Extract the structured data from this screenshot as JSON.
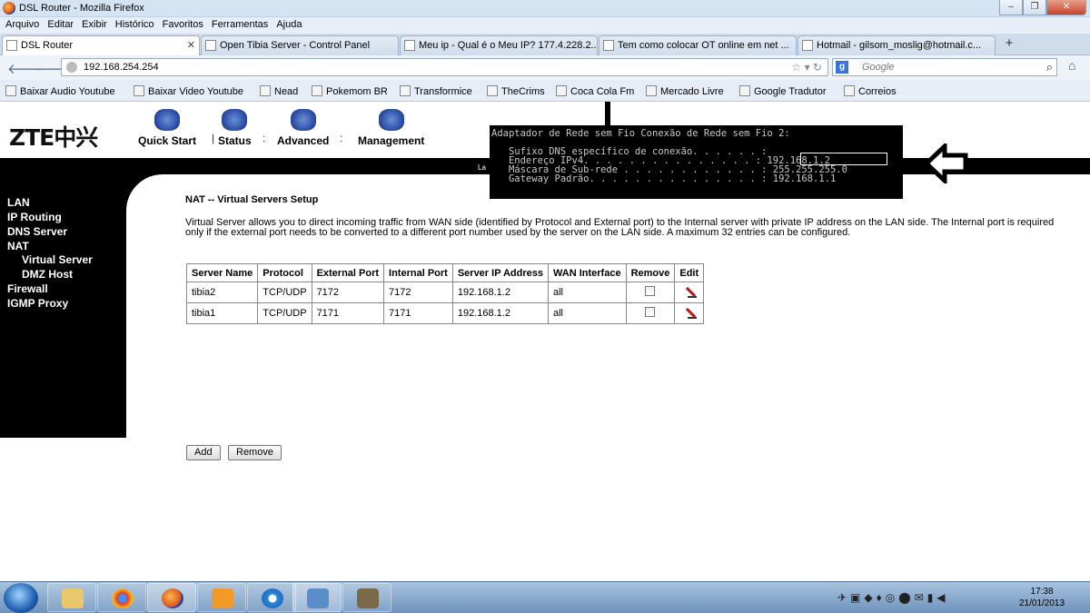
{
  "window": {
    "title": "DSL Router - Mozilla Firefox"
  },
  "menu": [
    "Arquivo",
    "Editar",
    "Exibir",
    "Histórico",
    "Favoritos",
    "Ferramentas",
    "Ajuda"
  ],
  "tabs": [
    {
      "label": "DSL Router"
    },
    {
      "label": "Open Tibia Server - Control Panel"
    },
    {
      "label": "Meu ip - Qual é o Meu IP? 177.4.228.2..."
    },
    {
      "label": "Tem como colocar OT online em net ..."
    },
    {
      "label": "Hotmail - gilsom_moslig@hotmail.c..."
    }
  ],
  "address": {
    "url": "192.168.254.254"
  },
  "search": {
    "placeholder": "Google"
  },
  "bookmarks": [
    "Baixar Audio Youtube",
    "Baixar Video Youtube",
    "Nead",
    "Pokemom BR",
    "Transformice",
    "TheCrims",
    "Coca Cola Fm",
    "Mercado Livre",
    "Google Tradutor",
    "Correios"
  ],
  "router": {
    "logo": "ZTE中兴",
    "topnav": {
      "quick_start": "Quick Start",
      "status": "Status",
      "advanced": "Advanced",
      "management": "Management"
    },
    "sidebar": {
      "lan": "LAN",
      "ip_routing": "IP Routing",
      "dns_server": "DNS Server",
      "nat": "NAT",
      "virtual_server": "Virtual Server",
      "dmz_host": "DMZ Host",
      "firewall": "Firewall",
      "igmp_proxy": "IGMP Proxy"
    },
    "page_title": "NAT -- Virtual Servers Setup",
    "description": "Virtual Server allows you to direct incoming traffic from WAN side (identified by Protocol and External port) to the Internal server with private IP address on the LAN side. The Internal port is required only if the external port needs to be converted to a different port number used by the server on the LAN side. A maximum 32 entries can be configured.",
    "table": {
      "headers": {
        "server_name": "Server Name",
        "protocol": "Protocol",
        "external_port": "External Port",
        "internal_port": "Internal Port",
        "server_ip": "Server IP Address",
        "wan_interface": "WAN Interface",
        "remove": "Remove",
        "edit": "Edit"
      },
      "rows": [
        {
          "server_name": "tibia2",
          "protocol": "TCP/UDP",
          "external_port": "7172",
          "internal_port": "7172",
          "server_ip": "192.168.1.2",
          "wan_interface": "all"
        },
        {
          "server_name": "tibia1",
          "protocol": "TCP/UDP",
          "external_port": "7171",
          "internal_port": "7171",
          "server_ip": "192.168.1.2",
          "wan_interface": "all"
        }
      ]
    },
    "buttons": {
      "add": "Add",
      "remove": "Remove"
    },
    "black_bar_text": "La"
  },
  "ipconfig": {
    "header": "Adaptador de Rede sem Fio Conexão de Rede sem Fio 2:",
    "line1": "   Sufixo DNS específico de conexão. . . . . . :",
    "line2": "   Endereço IPv4. . . . . . . . . . . . . . . : 192.168.1.2",
    "line3": "   Máscara de Sub-rede . . . . . . . . . . . . : 255.255.255.0",
    "line4": "   Gateway Padrão. . . . . . . . . . . . . . . : 192.168.1.1"
  },
  "clock": {
    "time": "17:38",
    "date": "21/01/2013"
  },
  "colors": {
    "sidebar_bg": "#000000",
    "titlebar_bg": "#d5e4f3",
    "taskbar_bg": "#6e93bd"
  }
}
